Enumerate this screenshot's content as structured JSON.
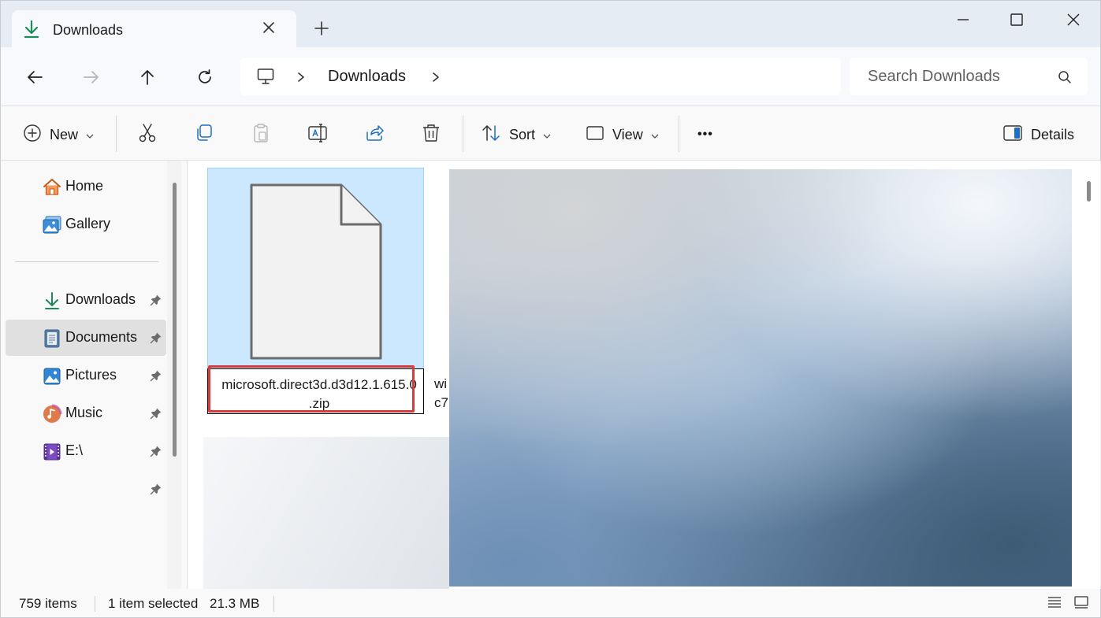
{
  "window": {
    "tab_title": "Downloads",
    "tab_icon": "download-arrow-icon"
  },
  "address_bar": {
    "root_icon": "this-pc-icon",
    "path": [
      "Downloads"
    ],
    "search_placeholder": "Search Downloads"
  },
  "command_bar": {
    "new_label": "New",
    "sort_label": "Sort",
    "view_label": "View",
    "details_label": "Details",
    "more_glyph": "•••"
  },
  "sidebar": {
    "top_items": [
      {
        "label": "Home",
        "icon": "home-icon"
      },
      {
        "label": "Gallery",
        "icon": "gallery-icon"
      }
    ],
    "pinned_items": [
      {
        "label": "Downloads",
        "icon": "downloads-icon",
        "selected": false
      },
      {
        "label": "Documents",
        "icon": "documents-icon",
        "selected": true
      },
      {
        "label": "Pictures",
        "icon": "pictures-icon",
        "selected": false
      },
      {
        "label": "Music",
        "icon": "music-icon",
        "selected": false
      },
      {
        "label": "E:\\",
        "icon": "videos-drive-icon",
        "selected": false
      },
      {
        "label": "",
        "icon": "",
        "selected": false
      }
    ]
  },
  "files": {
    "selected_name_line1": "microsoft.direct3d.d3d12.1.615.0",
    "selected_name_line2": ".zip",
    "second_name_line1": "wi",
    "second_name_line2": "c7"
  },
  "status": {
    "item_count": "759 items",
    "selection": "1 item selected",
    "size": "21.3 MB"
  },
  "colors": {
    "selection_fill": "#cce8ff",
    "highlight_box": "#d83b3b",
    "accent": "#0067c0",
    "download_green": "#1c8a5a"
  }
}
